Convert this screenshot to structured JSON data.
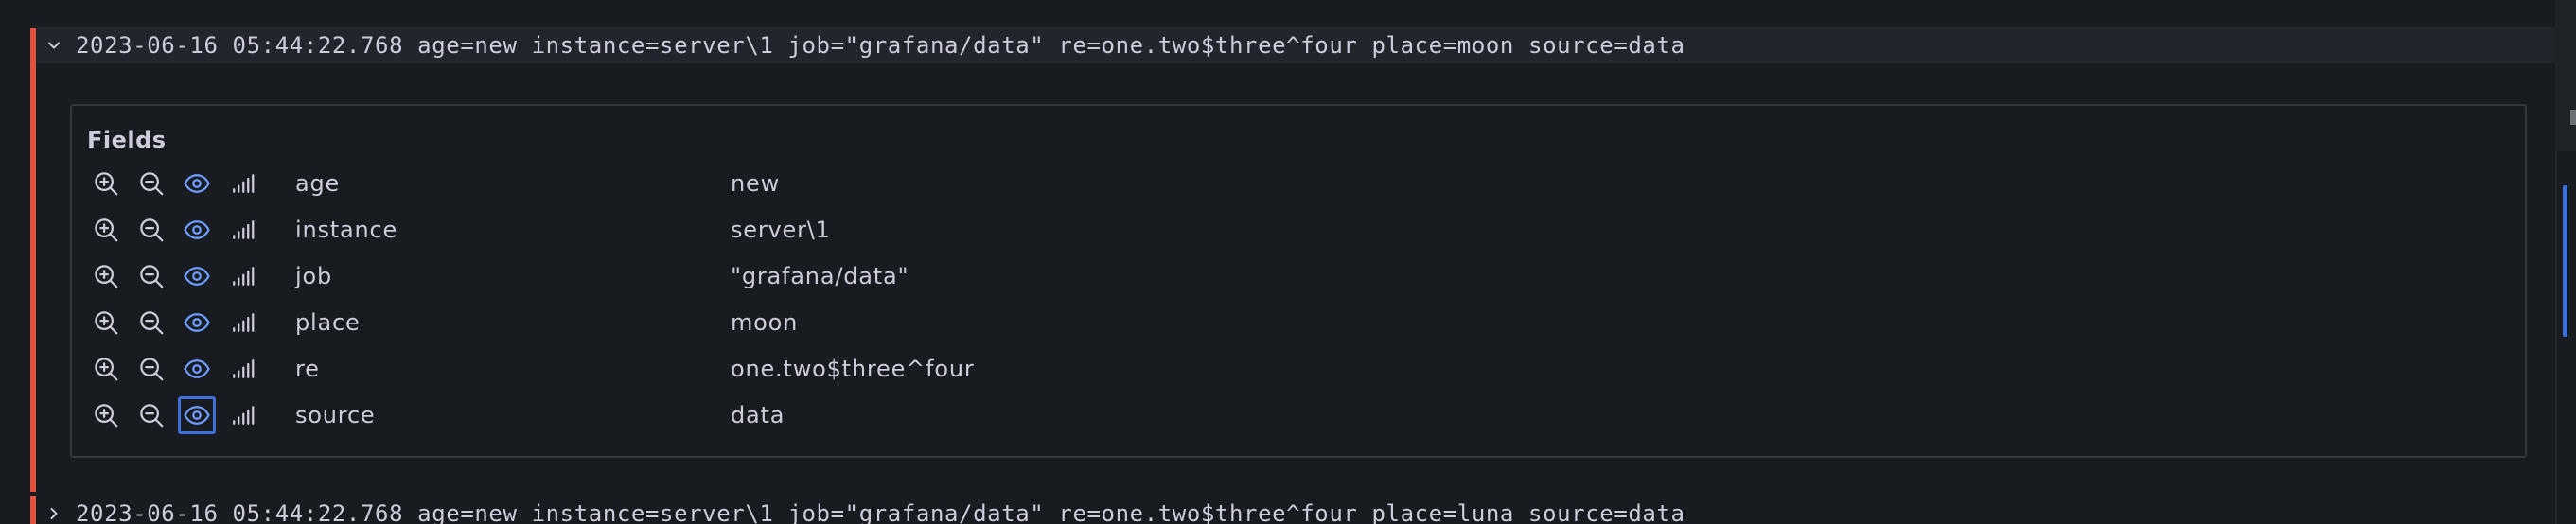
{
  "colors": {
    "background": "#181b1f",
    "row_highlight": "#22252b",
    "level_error": "#e0533e",
    "accent_blue": "#6e9fff",
    "text": "#ccccdc",
    "border": "#34373d"
  },
  "logs": [
    {
      "expanded": true,
      "line": "2023-06-16 05:44:22.768 age=new instance=server\\1 job=\"grafana/data\" re=one.two$three^four place=moon source=data",
      "chevron_icon": "chevron-down-icon"
    },
    {
      "expanded": false,
      "line": "2023-06-16 05:44:22.768 age=new instance=server\\1 job=\"grafana/data\" re=one.two$three^four place=luna source=data",
      "chevron_icon": "chevron-right-icon"
    }
  ],
  "details": {
    "title": "Fields",
    "fields": [
      {
        "key": "age",
        "value": "new"
      },
      {
        "key": "instance",
        "value": "server\\1"
      },
      {
        "key": "job",
        "value": "\"grafana/data\""
      },
      {
        "key": "place",
        "value": "moon"
      },
      {
        "key": "re",
        "value": "one.two$three^four"
      },
      {
        "key": "source",
        "value": "data"
      }
    ],
    "row_icons": [
      "zoom-in-icon",
      "zoom-out-icon",
      "eye-icon",
      "signal-bars-icon"
    ]
  }
}
